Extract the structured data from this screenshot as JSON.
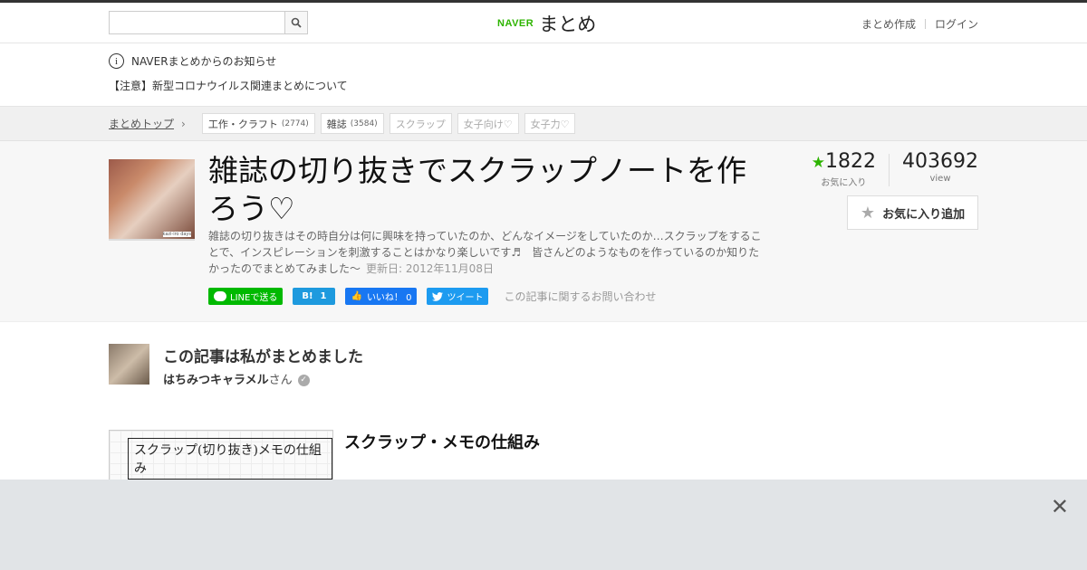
{
  "header": {
    "search_placeholder": "",
    "logo_naver": "NAVER",
    "logo_matome": "まとめ",
    "link_create": "まとめ作成",
    "link_login": "ログイン"
  },
  "notice": {
    "info_label": "NAVERまとめからのお知らせ",
    "message": "【注意】新型コロナウイルス関連まとめについて"
  },
  "breadcrumbs": {
    "home": "まとめトップ",
    "tags": [
      {
        "label": "工作・クラフト",
        "count": "(2774)"
      },
      {
        "label": "雑誌",
        "count": "(3584)"
      },
      {
        "label": "スクラップ",
        "count": ""
      },
      {
        "label": "女子向け♡",
        "count": ""
      },
      {
        "label": "女子力♡",
        "count": ""
      }
    ]
  },
  "article": {
    "thumb_caption": "kazi-iro days",
    "title": "雑誌の切り抜きでスクラップノートを作ろう♡",
    "description": "雑誌の切り抜きはその時自分は何に興味を持っていたのか、どんなイメージをしていたのか…スクラップをすることで、インスピレーションを刺激することはかなり楽しいです♬　皆さんどのようなものを作っているのか知りたかったのでまとめてみました～",
    "updated": "更新日: 2012年11月08日",
    "favorites": "1822",
    "favorites_label": "お気に入り",
    "views": "403692",
    "views_label": "view",
    "fav_button": "お気に入り追加"
  },
  "share": {
    "line": "LINEで送る",
    "hatena_count": "1",
    "fb_like": "いいね！ 0",
    "tweet": "ツイート",
    "inquiry": "この記事に関するお問い合わせ"
  },
  "author": {
    "heading": "この記事は私がまとめました",
    "name": "はちみつキャラメル",
    "suffix": "さん"
  },
  "section": {
    "image_text": "スクラップ(切り抜き)メモの仕組み",
    "title": "スクラップ・メモの仕組み"
  },
  "overlay": {
    "close": "✕"
  }
}
